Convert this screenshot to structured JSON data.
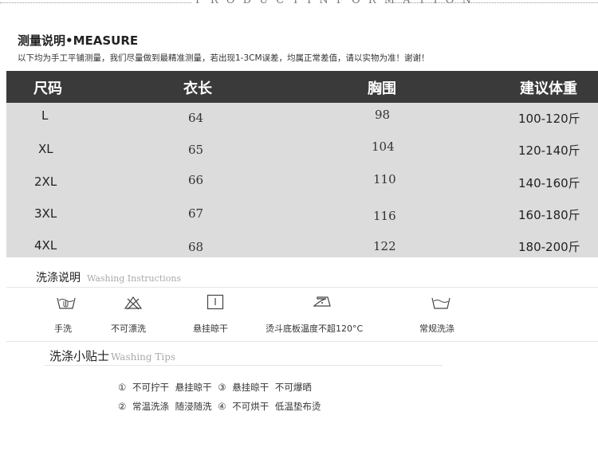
{
  "banner": {
    "text": "P R O D U C T   I N F O R M A T I O N"
  },
  "measure": {
    "title": "测量说明•MEASURE",
    "subtitle": "以下均为手工平铺测量，我们尽量做到最精准测量，若出现1-3CM误差，均属正常差值，请以实物为准！谢谢！"
  },
  "size_table": {
    "headers": [
      "尺码",
      "衣长",
      "胸围",
      "建议体重"
    ],
    "rows": [
      {
        "size": "L",
        "length": "64",
        "chest": "98",
        "weight": "100-120斤"
      },
      {
        "size": "XL",
        "length": "65",
        "chest": "104",
        "weight": "120-140斤"
      },
      {
        "size": "2XL",
        "length": "66",
        "chest": "110",
        "weight": "140-160斤"
      },
      {
        "size": "3XL",
        "length": "67",
        "chest": "116",
        "weight": "160-180斤"
      },
      {
        "size": "4XL",
        "length": "68",
        "chest": "122",
        "weight": "180-200斤"
      }
    ]
  },
  "washing": {
    "title": "洗涤说明",
    "title_en": "Washing Instructions",
    "items": [
      {
        "icon": "hand-wash-icon",
        "label": "手洗"
      },
      {
        "icon": "no-bleach-icon",
        "label": "不可漂洗"
      },
      {
        "icon": "hang-dry-icon",
        "label": "悬挂晾干"
      },
      {
        "icon": "iron-icon",
        "label": "烫斗底板温度不超120°C"
      },
      {
        "icon": "machine-wash-icon",
        "label": "常规洗涤"
      }
    ]
  },
  "tips": {
    "title": "洗涤小贴士",
    "title_en": "Washing Tips",
    "lines": [
      "① 不可拧干  悬挂晾干  ③ 悬挂晾干  不可爆晒",
      "② 常温洗涤  随浸随洗  ④ 不可烘干  低温垫布烫"
    ]
  }
}
